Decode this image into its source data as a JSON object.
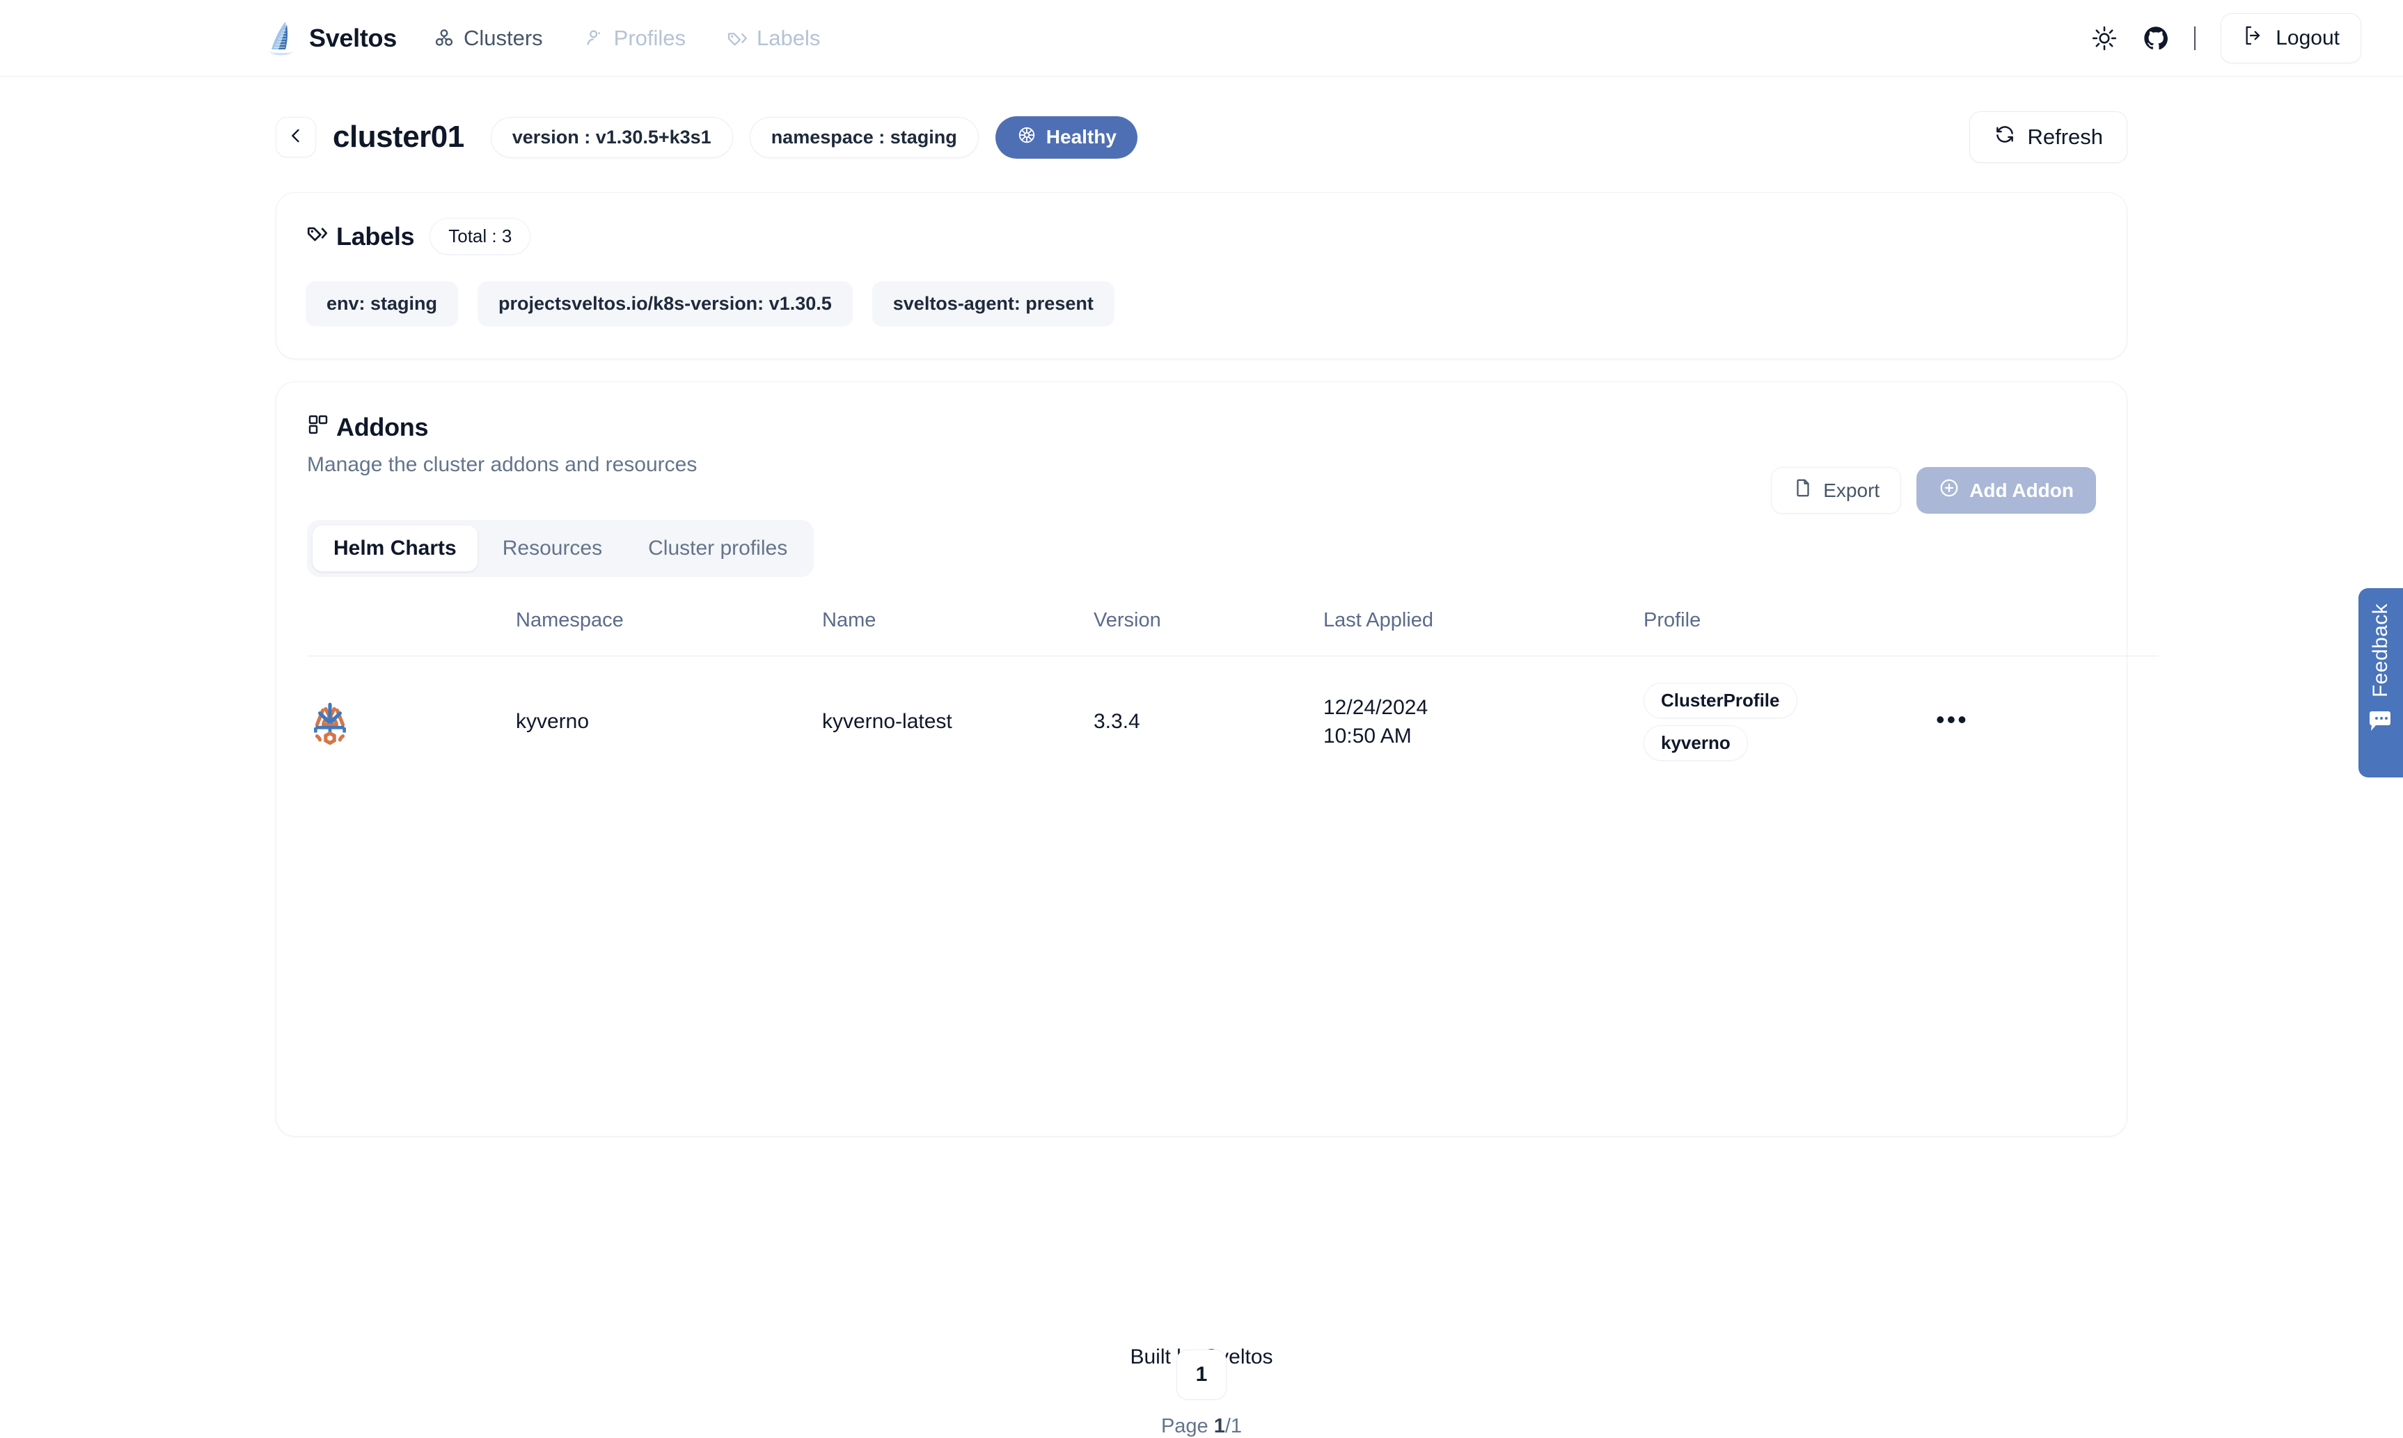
{
  "header": {
    "brand": "Sveltos",
    "nav": [
      {
        "label": "Clusters",
        "icon": "clusters-icon",
        "active": true
      },
      {
        "label": "Profiles",
        "icon": "profiles-icon",
        "active": false
      },
      {
        "label": "Labels",
        "icon": "labels-icon",
        "active": false
      }
    ],
    "theme_toggle_icon": "sun-icon",
    "github_icon": "github-icon",
    "divider": "|",
    "logout_label": "Logout"
  },
  "cluster": {
    "back_icon": "chevron-left-icon",
    "name": "cluster01",
    "version_pill": "version : v1.30.5+k3s1",
    "namespace_pill": "namespace : staging",
    "status": "Healthy",
    "status_color": "#4f6fb5",
    "status_icon": "kubernetes-helm-icon",
    "refresh_label": "Refresh"
  },
  "labels": {
    "title": "Labels",
    "title_icon": "tags-icon",
    "total": "Total : 3",
    "chips": [
      "env: staging",
      "projectsveltos.io/k8s-version: v1.30.5",
      "sveltos-agent: present"
    ]
  },
  "addons": {
    "title": "Addons",
    "title_icon": "layout-grid-icon",
    "subtitle": "Manage the cluster addons and resources",
    "export_label": "Export",
    "export_icon": "file-icon",
    "add_label": "Add Addon",
    "add_icon": "plus-circle-icon",
    "add_color": "#aab7d6",
    "tabs": [
      {
        "label": "Helm Charts",
        "active": true
      },
      {
        "label": "Resources",
        "active": false
      },
      {
        "label": "Cluster profiles",
        "active": false
      }
    ],
    "table": {
      "columns": [
        "",
        "Namespace",
        "Name",
        "Version",
        "Last Applied",
        "Profile",
        ""
      ],
      "rows": [
        {
          "logo": "kyverno-logo",
          "namespace": "kyverno",
          "name": "kyverno-latest",
          "version": "3.3.4",
          "last_applied_date": "12/24/2024",
          "last_applied_time": "10:50 AM",
          "profile_kind": "ClusterProfile",
          "profile_name": "kyverno",
          "actions_icon": "ellipsis-icon"
        }
      ]
    },
    "pagination": {
      "current_page": "1",
      "page_label": "Page",
      "page_current": "1",
      "page_total": "/1"
    }
  },
  "feedback": {
    "label": "Feedback",
    "icon": "speech-bubble-icon",
    "color": "#4a74bb"
  },
  "footer": {
    "text": "Built by Sveltos"
  }
}
